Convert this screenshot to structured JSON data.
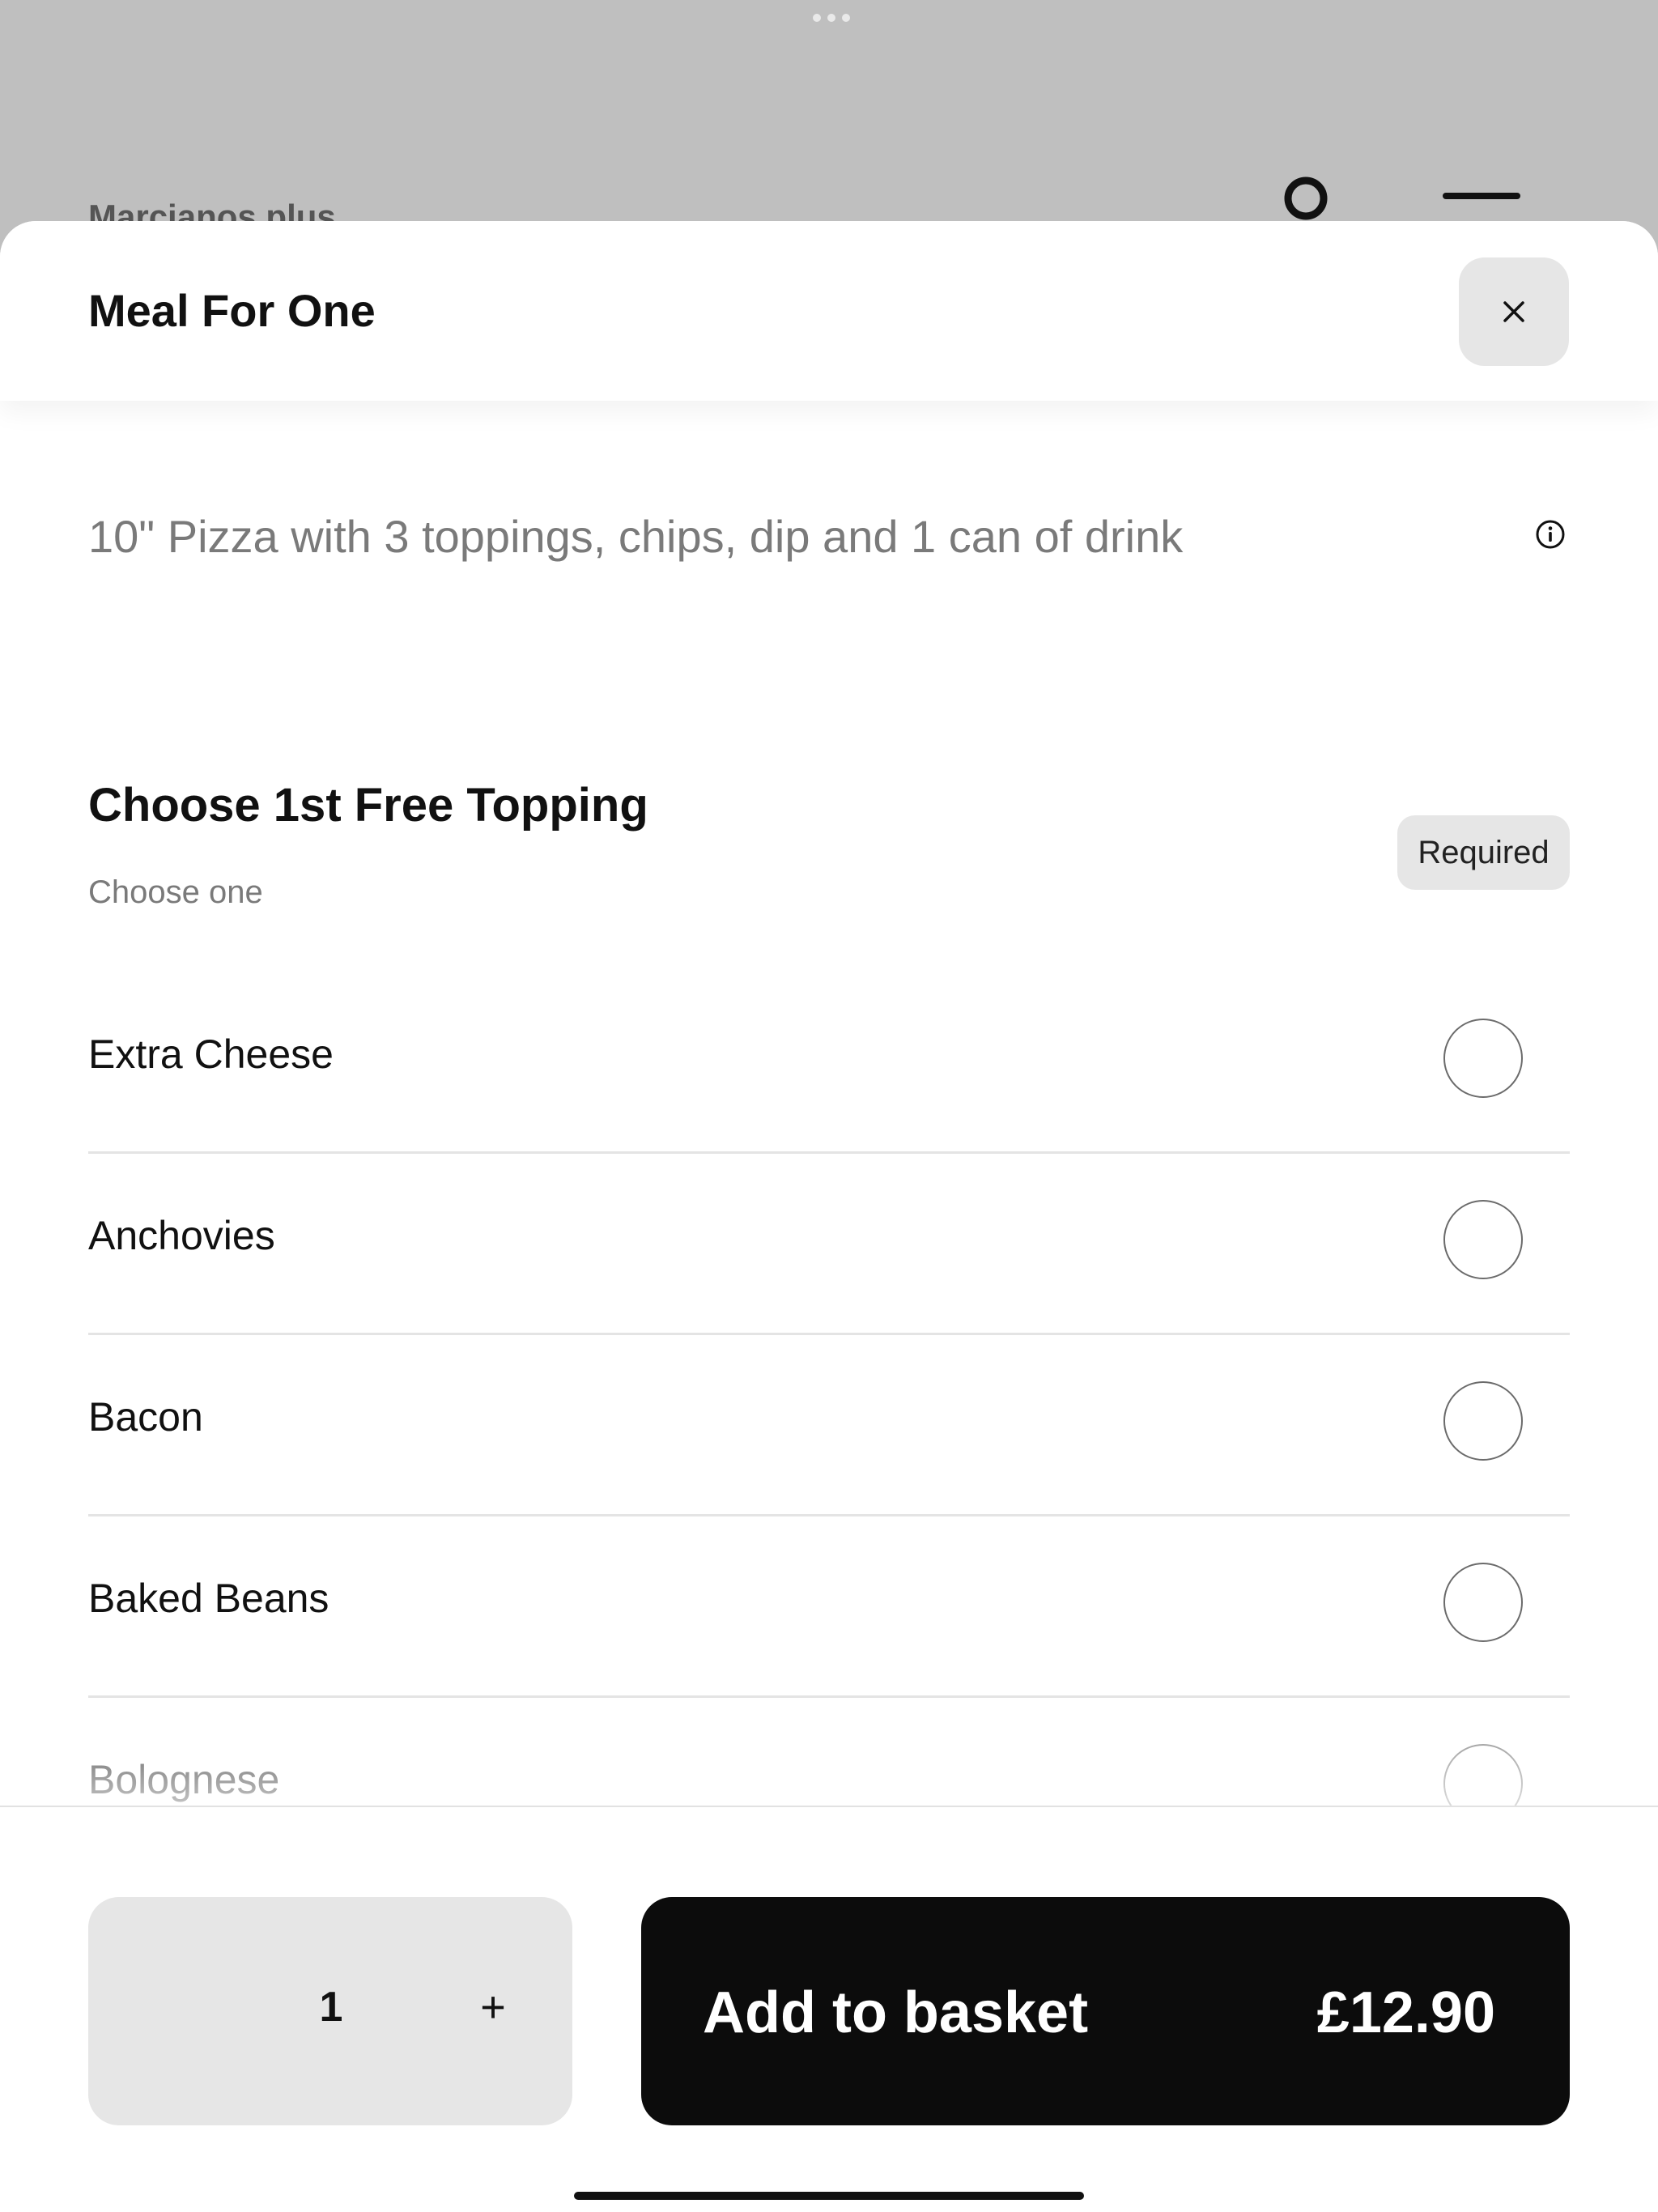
{
  "background": {
    "brand_name": "Marcianos plus",
    "account_icon": "account-circle-icon",
    "menu_icon": "hamburger-menu-icon"
  },
  "sheet": {
    "title": "Meal For One",
    "close_icon": "close-icon"
  },
  "item": {
    "description": "10\" Pizza with 3 toppings, chips, dip and 1 can of drink",
    "info_icon": "info-icon"
  },
  "option_group": {
    "title": "Choose 1st Free Topping",
    "subtitle": "Choose one",
    "badge": "Required",
    "options": [
      {
        "label": "Extra Cheese",
        "selected": false
      },
      {
        "label": "Anchovies",
        "selected": false
      },
      {
        "label": "Bacon",
        "selected": false
      },
      {
        "label": "Baked Beans",
        "selected": false
      },
      {
        "label": "Bolognese",
        "selected": false
      }
    ]
  },
  "footer": {
    "quantity": "1",
    "increment_label": "+",
    "add_label": "Add to basket",
    "price": "£12.90"
  },
  "colors": {
    "accent": "#0c0c0c",
    "backdrop": "#bfbfbf",
    "muted_text": "#7a7a7a",
    "chip_bg": "#e6e6e6"
  }
}
